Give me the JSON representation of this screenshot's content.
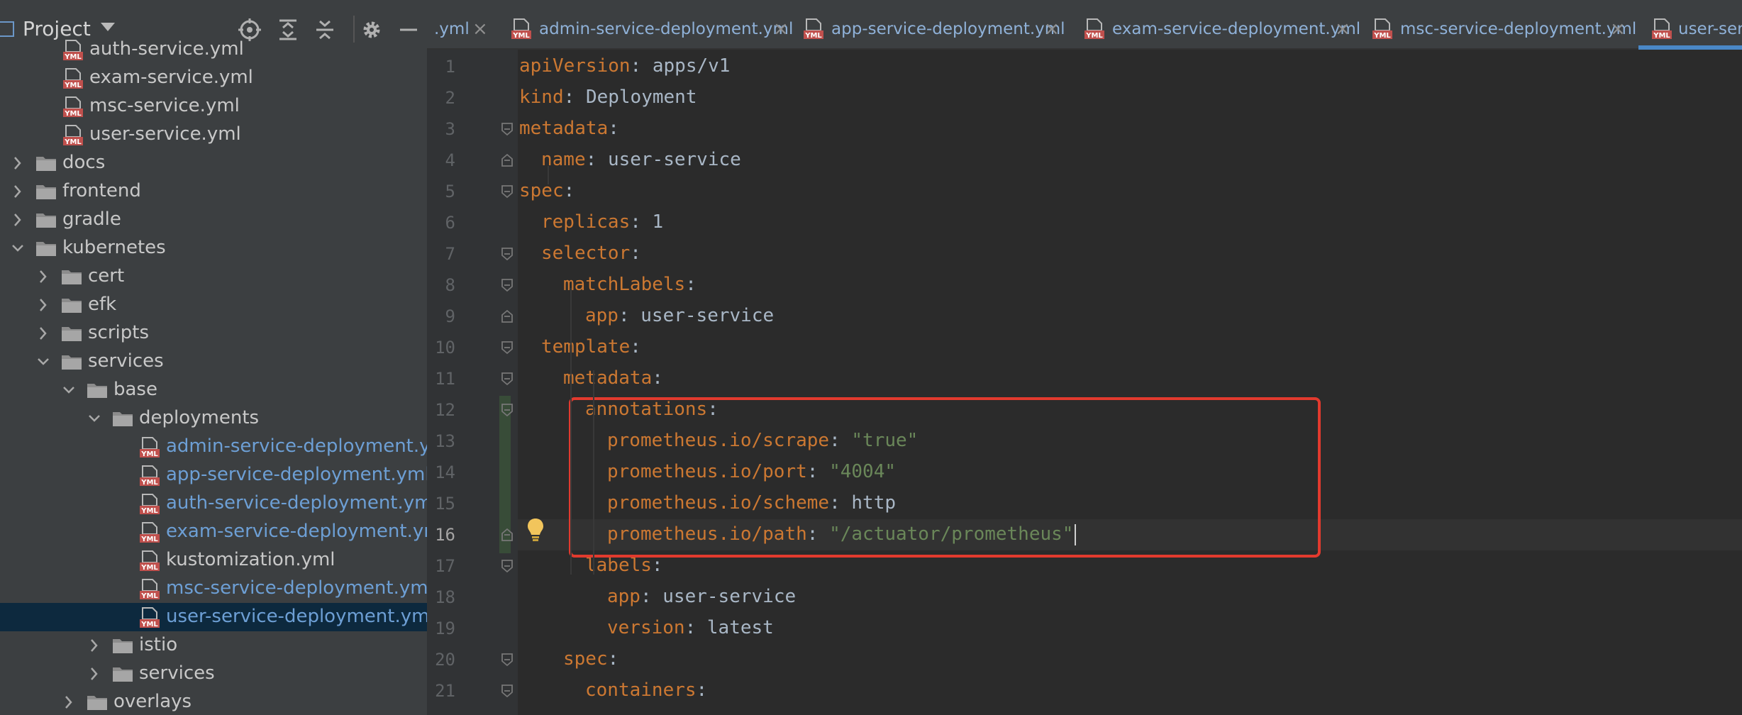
{
  "project_panel": {
    "title": "Project",
    "tree": [
      {
        "label": "auth-service.yml",
        "type": "yml",
        "depth": 2,
        "color": "default"
      },
      {
        "label": "exam-service.yml",
        "type": "yml",
        "depth": 2,
        "color": "default"
      },
      {
        "label": "msc-service.yml",
        "type": "yml",
        "depth": 2,
        "color": "default"
      },
      {
        "label": "user-service.yml",
        "type": "yml",
        "depth": 2,
        "color": "default"
      },
      {
        "label": "docs",
        "type": "folder",
        "depth": 0,
        "expanded": false
      },
      {
        "label": "frontend",
        "type": "folder",
        "depth": 0,
        "expanded": false
      },
      {
        "label": "gradle",
        "type": "folder",
        "depth": 0,
        "expanded": false
      },
      {
        "label": "kubernetes",
        "type": "folder",
        "depth": 0,
        "expanded": true
      },
      {
        "label": "cert",
        "type": "folder",
        "depth": 1,
        "expanded": false
      },
      {
        "label": "efk",
        "type": "folder",
        "depth": 1,
        "expanded": false
      },
      {
        "label": "scripts",
        "type": "folder",
        "depth": 1,
        "expanded": false
      },
      {
        "label": "services",
        "type": "folder",
        "depth": 1,
        "expanded": true
      },
      {
        "label": "base",
        "type": "folder",
        "depth": 2,
        "expanded": true
      },
      {
        "label": "deployments",
        "type": "folder",
        "depth": 3,
        "expanded": true
      },
      {
        "label": "admin-service-deployment.yml",
        "type": "yml",
        "depth": 4,
        "color": "blue"
      },
      {
        "label": "app-service-deployment.yml",
        "type": "yml",
        "depth": 4,
        "color": "blue"
      },
      {
        "label": "auth-service-deployment.yml",
        "type": "yml",
        "depth": 4,
        "color": "blue"
      },
      {
        "label": "exam-service-deployment.yml",
        "type": "yml",
        "depth": 4,
        "color": "blue"
      },
      {
        "label": "kustomization.yml",
        "type": "yml",
        "depth": 4,
        "color": "default"
      },
      {
        "label": "msc-service-deployment.yml",
        "type": "yml",
        "depth": 4,
        "color": "blue"
      },
      {
        "label": "user-service-deployment.yml",
        "type": "yml",
        "depth": 4,
        "color": "blue",
        "selected": true
      },
      {
        "label": "istio",
        "type": "folder",
        "depth": 3,
        "expanded": false
      },
      {
        "label": "services",
        "type": "folder",
        "depth": 3,
        "expanded": false
      },
      {
        "label": "overlays",
        "type": "folder",
        "depth": 2,
        "expanded": false
      }
    ]
  },
  "tabs": [
    {
      "label": ".yml",
      "active": false
    },
    {
      "label": "admin-service-deployment.yml",
      "active": false
    },
    {
      "label": "app-service-deployment.yml",
      "active": false
    },
    {
      "label": "exam-service-deployment.yml",
      "active": false
    },
    {
      "label": "msc-service-deployment.yml",
      "active": false
    },
    {
      "label": "user-serv",
      "active": true
    }
  ],
  "editor": {
    "current_line": 16,
    "lines": [
      {
        "n": "1",
        "indent": 0,
        "key": "apiVersion",
        "value": "apps/v1",
        "vtype": "plain"
      },
      {
        "n": "2",
        "indent": 0,
        "key": "kind",
        "value": "Deployment",
        "vtype": "plain"
      },
      {
        "n": "3",
        "indent": 0,
        "key": "metadata",
        "value": "",
        "vtype": "none"
      },
      {
        "n": "4",
        "indent": 1,
        "key": "name",
        "value": "user-service",
        "vtype": "plain"
      },
      {
        "n": "5",
        "indent": 0,
        "key": "spec",
        "value": "",
        "vtype": "none"
      },
      {
        "n": "6",
        "indent": 1,
        "key": "replicas",
        "value": "1",
        "vtype": "plain"
      },
      {
        "n": "7",
        "indent": 1,
        "key": "selector",
        "value": "",
        "vtype": "none"
      },
      {
        "n": "8",
        "indent": 2,
        "key": "matchLabels",
        "value": "",
        "vtype": "none"
      },
      {
        "n": "9",
        "indent": 3,
        "key": "app",
        "value": "user-service",
        "vtype": "plain"
      },
      {
        "n": "10",
        "indent": 1,
        "key": "template",
        "value": "",
        "vtype": "none"
      },
      {
        "n": "11",
        "indent": 2,
        "key": "metadata",
        "value": "",
        "vtype": "none"
      },
      {
        "n": "12",
        "indent": 3,
        "key": "annotations",
        "value": "",
        "vtype": "none"
      },
      {
        "n": "13",
        "indent": 4,
        "key": "prometheus.io/scrape",
        "value": "\"true\"",
        "vtype": "string"
      },
      {
        "n": "14",
        "indent": 4,
        "key": "prometheus.io/port",
        "value": "\"4004\"",
        "vtype": "string"
      },
      {
        "n": "15",
        "indent": 4,
        "key": "prometheus.io/scheme",
        "value": "http",
        "vtype": "plain"
      },
      {
        "n": "16",
        "indent": 4,
        "key": "prometheus.io/path",
        "value": "\"/actuator/prometheus\"",
        "vtype": "string"
      },
      {
        "n": "17",
        "indent": 3,
        "key": "labels",
        "value": "",
        "vtype": "none"
      },
      {
        "n": "18",
        "indent": 4,
        "key": "app",
        "value": "user-service",
        "vtype": "plain"
      },
      {
        "n": "19",
        "indent": 4,
        "key": "version",
        "value": "latest",
        "vtype": "plain"
      },
      {
        "n": "20",
        "indent": 2,
        "key": "spec",
        "value": "",
        "vtype": "none"
      },
      {
        "n": "21",
        "indent": 3,
        "key": "containers",
        "value": "",
        "vtype": "none"
      }
    ]
  },
  "colors": {
    "key": "#cc7832",
    "string": "#6a8759",
    "plain": "#a9b7c6",
    "highlight_box": "#e23a2e",
    "selection": "#0d293e"
  },
  "icons": [
    "project-icon",
    "locate-icon",
    "expand-all-icon",
    "collapse-all-icon",
    "gear-icon",
    "minimize-icon",
    "yml-file-icon",
    "folder-icon",
    "lightbulb-icon"
  ]
}
